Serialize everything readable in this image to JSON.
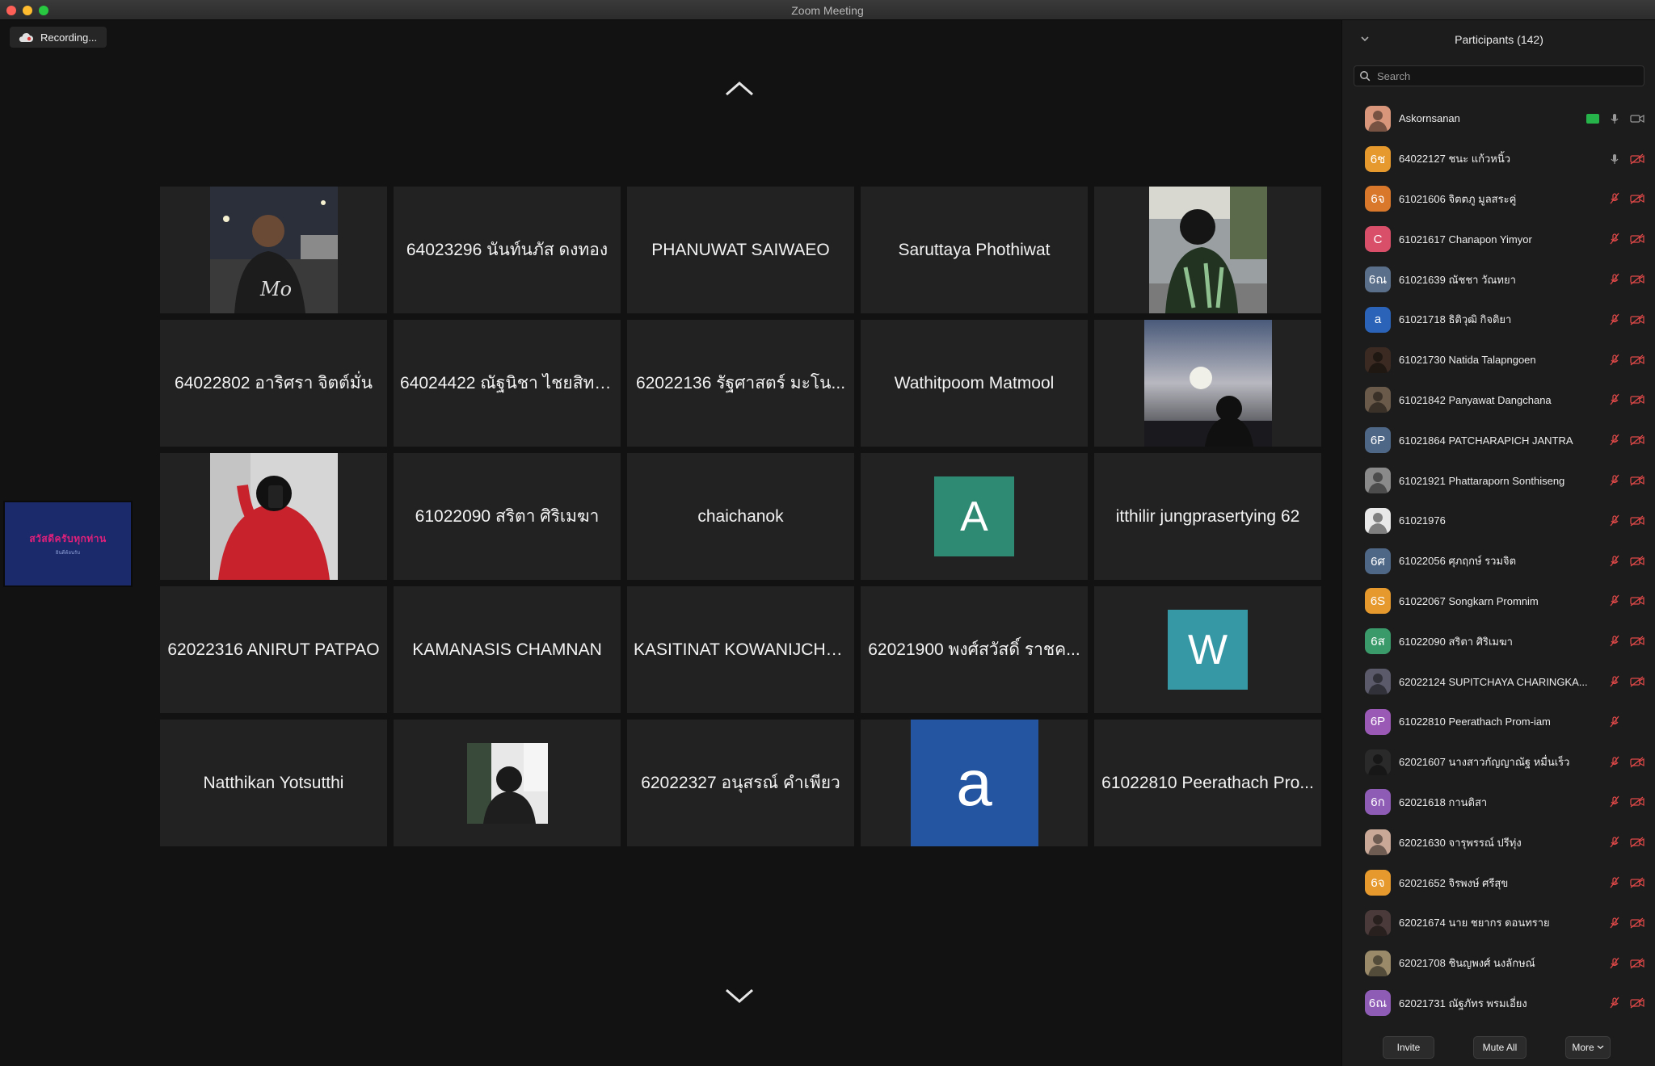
{
  "window": {
    "title": "Zoom Meeting"
  },
  "recording": {
    "label": "Recording..."
  },
  "grid": {
    "tiles": [
      {
        "type": "photo",
        "photo": "person-dark-shirt-night"
      },
      {
        "type": "name",
        "name": "64023296 นันท์นภัส ดงทอง"
      },
      {
        "type": "name",
        "name": "PHANUWAT SAIWAEO"
      },
      {
        "type": "name",
        "name": "Saruttaya Phothiwat"
      },
      {
        "type": "photo",
        "photo": "person-back-jacket-road"
      },
      {
        "type": "name",
        "name": "64022802 อาริศรา จิตต์มั่น"
      },
      {
        "type": "name",
        "name": "64024422 ณัฐนิชา ไชยสิทธิ์..."
      },
      {
        "type": "name",
        "name": "62022136 รัฐศาสตร์ มะโน..."
      },
      {
        "type": "name",
        "name": "Wathitpoom Matmool"
      },
      {
        "type": "photo",
        "photo": "silhouette-sunset-sky"
      },
      {
        "type": "photo",
        "photo": "person-red-hoodie-selfie"
      },
      {
        "type": "name",
        "name": "61022090 สริตา ศิริเมฆา"
      },
      {
        "type": "name",
        "name": "chaichanok"
      },
      {
        "type": "letter",
        "letter": "A",
        "color": "#2f8a74",
        "size": "medium"
      },
      {
        "type": "name",
        "name": "itthilir jungprasertying 62"
      },
      {
        "type": "name",
        "name": "62022316 ANIRUT PATPAO"
      },
      {
        "type": "name",
        "name": "KAMANASIS CHAMNAN"
      },
      {
        "type": "name",
        "name": "KASITINAT KOWANIJCHK..."
      },
      {
        "type": "name",
        "name": "62021900 พงศ์สวัสดิ์ ราชค..."
      },
      {
        "type": "letter",
        "letter": "W",
        "color": "#3698a5",
        "size": "medium"
      },
      {
        "type": "name",
        "name": "Natthikan Yotsutthi"
      },
      {
        "type": "photo",
        "photo": "person-room-small"
      },
      {
        "type": "name",
        "name": "62022327 อนุสรณ์ คำเพียว"
      },
      {
        "type": "letter",
        "letter": "a",
        "color": "#2455a0",
        "size": "large"
      },
      {
        "type": "name",
        "name": "61022810 Peerathach Pro..."
      }
    ]
  },
  "side_thumbnail": {
    "title": "สวัสดีครับทุกท่าน",
    "subtitle": "ยินดีต้อนรับ"
  },
  "participants": {
    "header": "Participants (142)",
    "search_placeholder": "Search",
    "items": [
      {
        "name": "Askornsanan",
        "avatar_type": "photo",
        "avatar_color": "#d9967a",
        "sharing": true,
        "mic": "on",
        "video": "on"
      },
      {
        "name": "64022127 ชนะ แก้วหนิ้ว",
        "avatar_type": "letter",
        "avatar_text": "6ช",
        "avatar_color": "#e69a2e",
        "mic": "on",
        "video": "off"
      },
      {
        "name": "61021606 จิตตภู มูลสระคู่",
        "avatar_type": "letter",
        "avatar_text": "6จ",
        "avatar_color": "#d9782a",
        "mic": "off",
        "video": "off"
      },
      {
        "name": "61021617 Chanapon Yimyor",
        "avatar_type": "letter",
        "avatar_text": "C",
        "avatar_color": "#d94f6a",
        "mic": "off",
        "video": "off"
      },
      {
        "name": "61021639 ณัชชา วัณทยา",
        "avatar_type": "letter",
        "avatar_text": "6ณ",
        "avatar_color": "#5a6f8a",
        "mic": "off",
        "video": "off"
      },
      {
        "name": "61021718 ธิติวุฒิ กิจติยา",
        "avatar_type": "letter",
        "avatar_text": "a",
        "avatar_color": "#2a63b8",
        "mic": "off",
        "video": "off"
      },
      {
        "name": "61021730 Natida Talapngoen",
        "avatar_type": "photo",
        "avatar_color": "#3a2a22",
        "mic": "off",
        "video": "off"
      },
      {
        "name": "61021842 Panyawat Dangchana",
        "avatar_type": "photo",
        "avatar_color": "#6a5a4a",
        "mic": "off",
        "video": "off"
      },
      {
        "name": "61021864 PATCHARAPICH JANTRA",
        "avatar_type": "letter",
        "avatar_text": "6P",
        "avatar_color": "#4f6786",
        "mic": "off",
        "video": "off"
      },
      {
        "name": "61021921 Phattaraporn Sonthiseng",
        "avatar_type": "photo",
        "avatar_color": "#8a8a8a",
        "mic": "off",
        "video": "off"
      },
      {
        "name": "61021976",
        "avatar_type": "photo",
        "avatar_color": "#e8e8e8",
        "mic": "off",
        "video": "off"
      },
      {
        "name": "61022056 ศุภฤกษ์ รวมจิต",
        "avatar_type": "letter",
        "avatar_text": "6ศ",
        "avatar_color": "#4f6786",
        "mic": "off",
        "video": "off"
      },
      {
        "name": "61022067     Songkarn Promnim",
        "avatar_type": "letter",
        "avatar_text": "6S",
        "avatar_color": "#e69a2e",
        "mic": "off",
        "video": "off"
      },
      {
        "name": "61022090 สริตา ศิริเมฆา",
        "avatar_type": "letter",
        "avatar_text": "6ส",
        "avatar_color": "#3a9a6a",
        "mic": "off",
        "video": "off"
      },
      {
        "name": "62022124 SUPITCHAYA CHARINGKA...",
        "avatar_type": "photo",
        "avatar_color": "#5a5a6a",
        "mic": "off",
        "video": "off"
      },
      {
        "name": "61022810 Peerathach Prom-iam",
        "avatar_type": "letter",
        "avatar_text": "6P",
        "avatar_color": "#9b59b6",
        "mic": "off",
        "video": "none"
      },
      {
        "name": "62021607 นางสาวกัญญาณัฐ หมื่นเร็ว",
        "avatar_type": "photo",
        "avatar_color": "#2a2a2a",
        "mic": "off",
        "video": "off"
      },
      {
        "name": "62021618 กานติสา",
        "avatar_type": "letter",
        "avatar_text": "6ก",
        "avatar_color": "#8e5bb5",
        "mic": "off",
        "video": "off"
      },
      {
        "name": "62021630 จารุพรรณ์ ปรีทุ่ง",
        "avatar_type": "photo",
        "avatar_color": "#c9a898",
        "mic": "off",
        "video": "off"
      },
      {
        "name": "62021652 จิรพงษ์ ศรีสุข",
        "avatar_type": "letter",
        "avatar_text": "6จ",
        "avatar_color": "#e69a2e",
        "mic": "off",
        "video": "off"
      },
      {
        "name": "62021674 นาย ชยากร ดอนทราย",
        "avatar_type": "photo",
        "avatar_color": "#4a3a3a",
        "mic": "off",
        "video": "off"
      },
      {
        "name": "62021708 ชินญพงศ์ นงลักษณ์",
        "avatar_type": "photo",
        "avatar_color": "#9a8a6a",
        "mic": "off",
        "video": "off"
      },
      {
        "name": "62021731 ณัฐภัทร พรมเอี่ยง",
        "avatar_type": "letter",
        "avatar_text": "6ณ",
        "avatar_color": "#8e5bb5",
        "mic": "off",
        "video": "off"
      }
    ]
  },
  "footer": {
    "invite": "Invite",
    "mute_all": "Mute All",
    "more": "More"
  }
}
